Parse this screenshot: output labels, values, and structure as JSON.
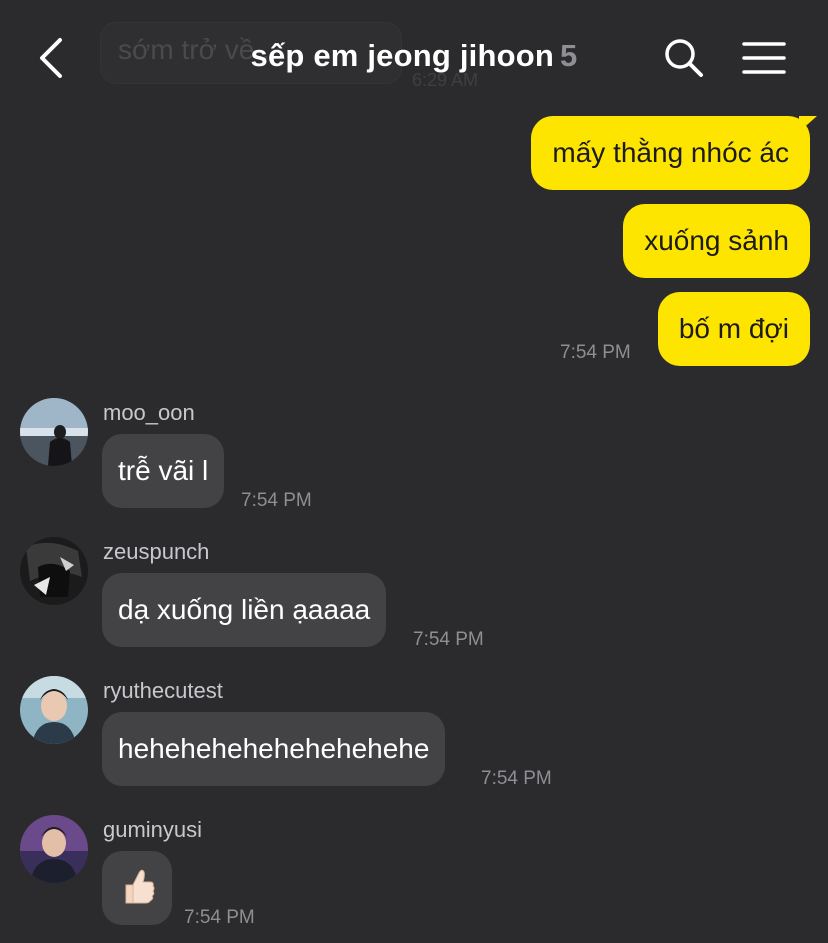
{
  "header": {
    "title": "sếp em jeong jihoon",
    "member_count": "5"
  },
  "ghost": {
    "text": "sớm trở về...",
    "time": "6:29 AM"
  },
  "outgoing": [
    {
      "text": "mấy thằng nhóc ác"
    },
    {
      "text": "xuống sảnh"
    },
    {
      "text": "bố m đợi",
      "time": "7:54 PM"
    }
  ],
  "incoming": [
    {
      "sender": "moo_oon",
      "text": "trễ vãi l",
      "time": "7:54 PM"
    },
    {
      "sender": "zeuspunch",
      "text": "dạ xuống liền ạaaaa",
      "time": "7:54 PM"
    },
    {
      "sender": "ryuthecutest",
      "text": "hehehehehehehehehehe",
      "time": "7:54 PM"
    },
    {
      "sender": "guminyusi",
      "text": "👍🏻",
      "time": "7:54 PM"
    }
  ],
  "colors": {
    "background": "#2b2b2e",
    "outgoing_bubble": "#fee500",
    "incoming_bubble": "#434346",
    "secondary_text": "#8e8e93"
  },
  "icons": [
    "back-arrow-icon",
    "search-icon",
    "menu-icon",
    "thumbs-up-emoji"
  ]
}
